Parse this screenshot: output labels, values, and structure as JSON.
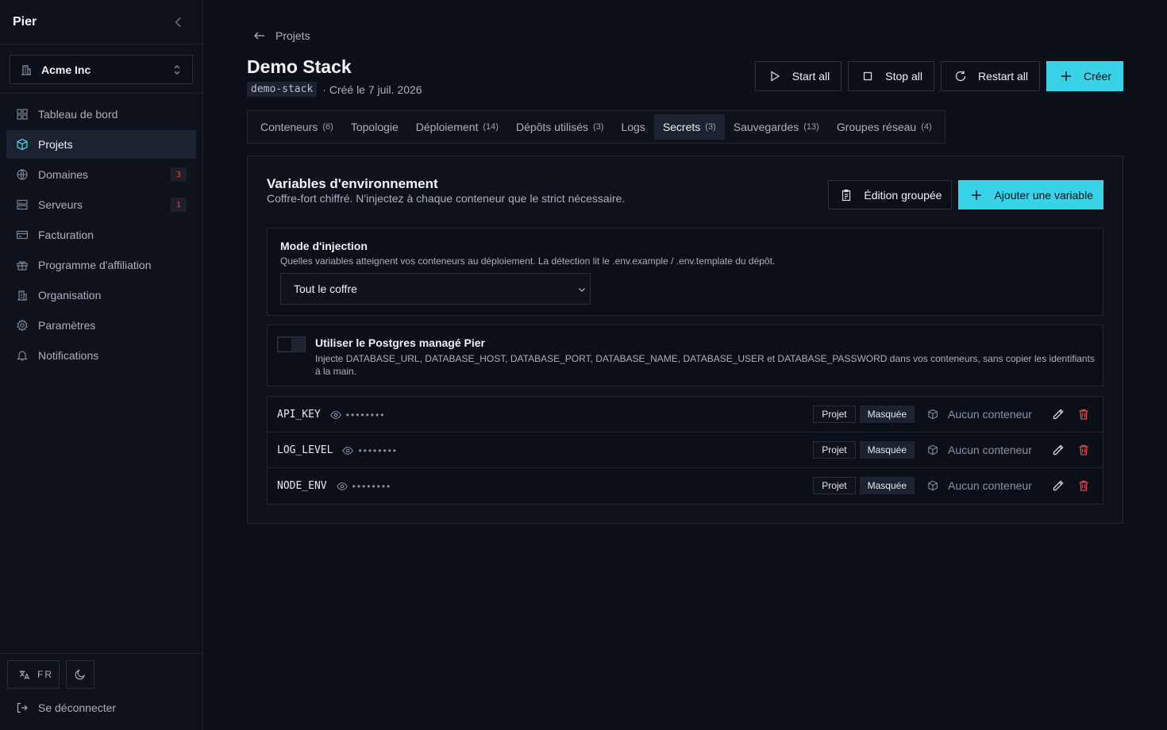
{
  "app": {
    "brand": "Pier"
  },
  "org": {
    "name": "Acme Inc"
  },
  "sidebar": {
    "items": [
      {
        "label": "Tableau de bord",
        "icon": "dashboard-icon"
      },
      {
        "label": "Projets",
        "icon": "cube-icon",
        "active": true
      },
      {
        "label": "Domaines",
        "icon": "globe-icon",
        "badge": "3"
      },
      {
        "label": "Serveurs",
        "icon": "server-icon",
        "badge": "1"
      },
      {
        "label": "Facturation",
        "icon": "credit-card-icon"
      },
      {
        "label": "Programme d'affiliation",
        "icon": "gift-icon"
      },
      {
        "label": "Organisation",
        "icon": "building-icon"
      },
      {
        "label": "Paramètres",
        "icon": "gear-icon"
      },
      {
        "label": "Notifications",
        "icon": "bell-icon"
      }
    ],
    "lang": "FR",
    "logout": "Se déconnecter"
  },
  "header": {
    "back": "Projets",
    "title": "Demo Stack",
    "slug": "demo-stack",
    "created": "· Créé le 7 juil. 2026",
    "actions": {
      "start": "Start all",
      "stop": "Stop all",
      "restart": "Restart all",
      "create": "Créer"
    }
  },
  "tabs": [
    {
      "label": "Conteneurs",
      "count": "(6)"
    },
    {
      "label": "Topologie",
      "count": ""
    },
    {
      "label": "Déploiement",
      "count": "(14)"
    },
    {
      "label": "Dépôts utilisés",
      "count": "(3)"
    },
    {
      "label": "Logs",
      "count": ""
    },
    {
      "label": "Secrets",
      "count": "(3)",
      "active": true
    },
    {
      "label": "Sauvegardes",
      "count": "(13)"
    },
    {
      "label": "Groupes réseau",
      "count": "(4)"
    }
  ],
  "env": {
    "title": "Variables d'environnement",
    "subtitle": "Coffre-fort chiffré. N'injectez à chaque conteneur que le strict nécessaire.",
    "bulk_edit": "Édition groupée",
    "add_var": "Ajouter une variable",
    "injection": {
      "label": "Mode d'injection",
      "help": "Quelles variables atteignent vos conteneurs au déploiement. La détection lit le .env.example / .env.template du dépôt.",
      "selected": "Tout le coffre"
    },
    "postgres": {
      "label": "Utiliser le Postgres managé Pier",
      "help": "Injecte DATABASE_URL, DATABASE_HOST, DATABASE_PORT, DATABASE_NAME, DATABASE_USER et DATABASE_PASSWORD dans vos conteneurs, sans copier les identifiants à la main.",
      "enabled": false
    },
    "variables": [
      {
        "key": "API_KEY",
        "masked": "••••••••",
        "scope": "Projet",
        "visibility": "Masquée",
        "containers": "Aucun conteneur"
      },
      {
        "key": "LOG_LEVEL",
        "masked": "••••••••",
        "scope": "Projet",
        "visibility": "Masquée",
        "containers": "Aucun conteneur"
      },
      {
        "key": "NODE_ENV",
        "masked": "••••••••",
        "scope": "Projet",
        "visibility": "Masquée",
        "containers": "Aucun conteneur"
      }
    ]
  },
  "colors": {
    "accent": "#38d3e6",
    "danger": "#e5484d",
    "background": "#0b0f17"
  }
}
